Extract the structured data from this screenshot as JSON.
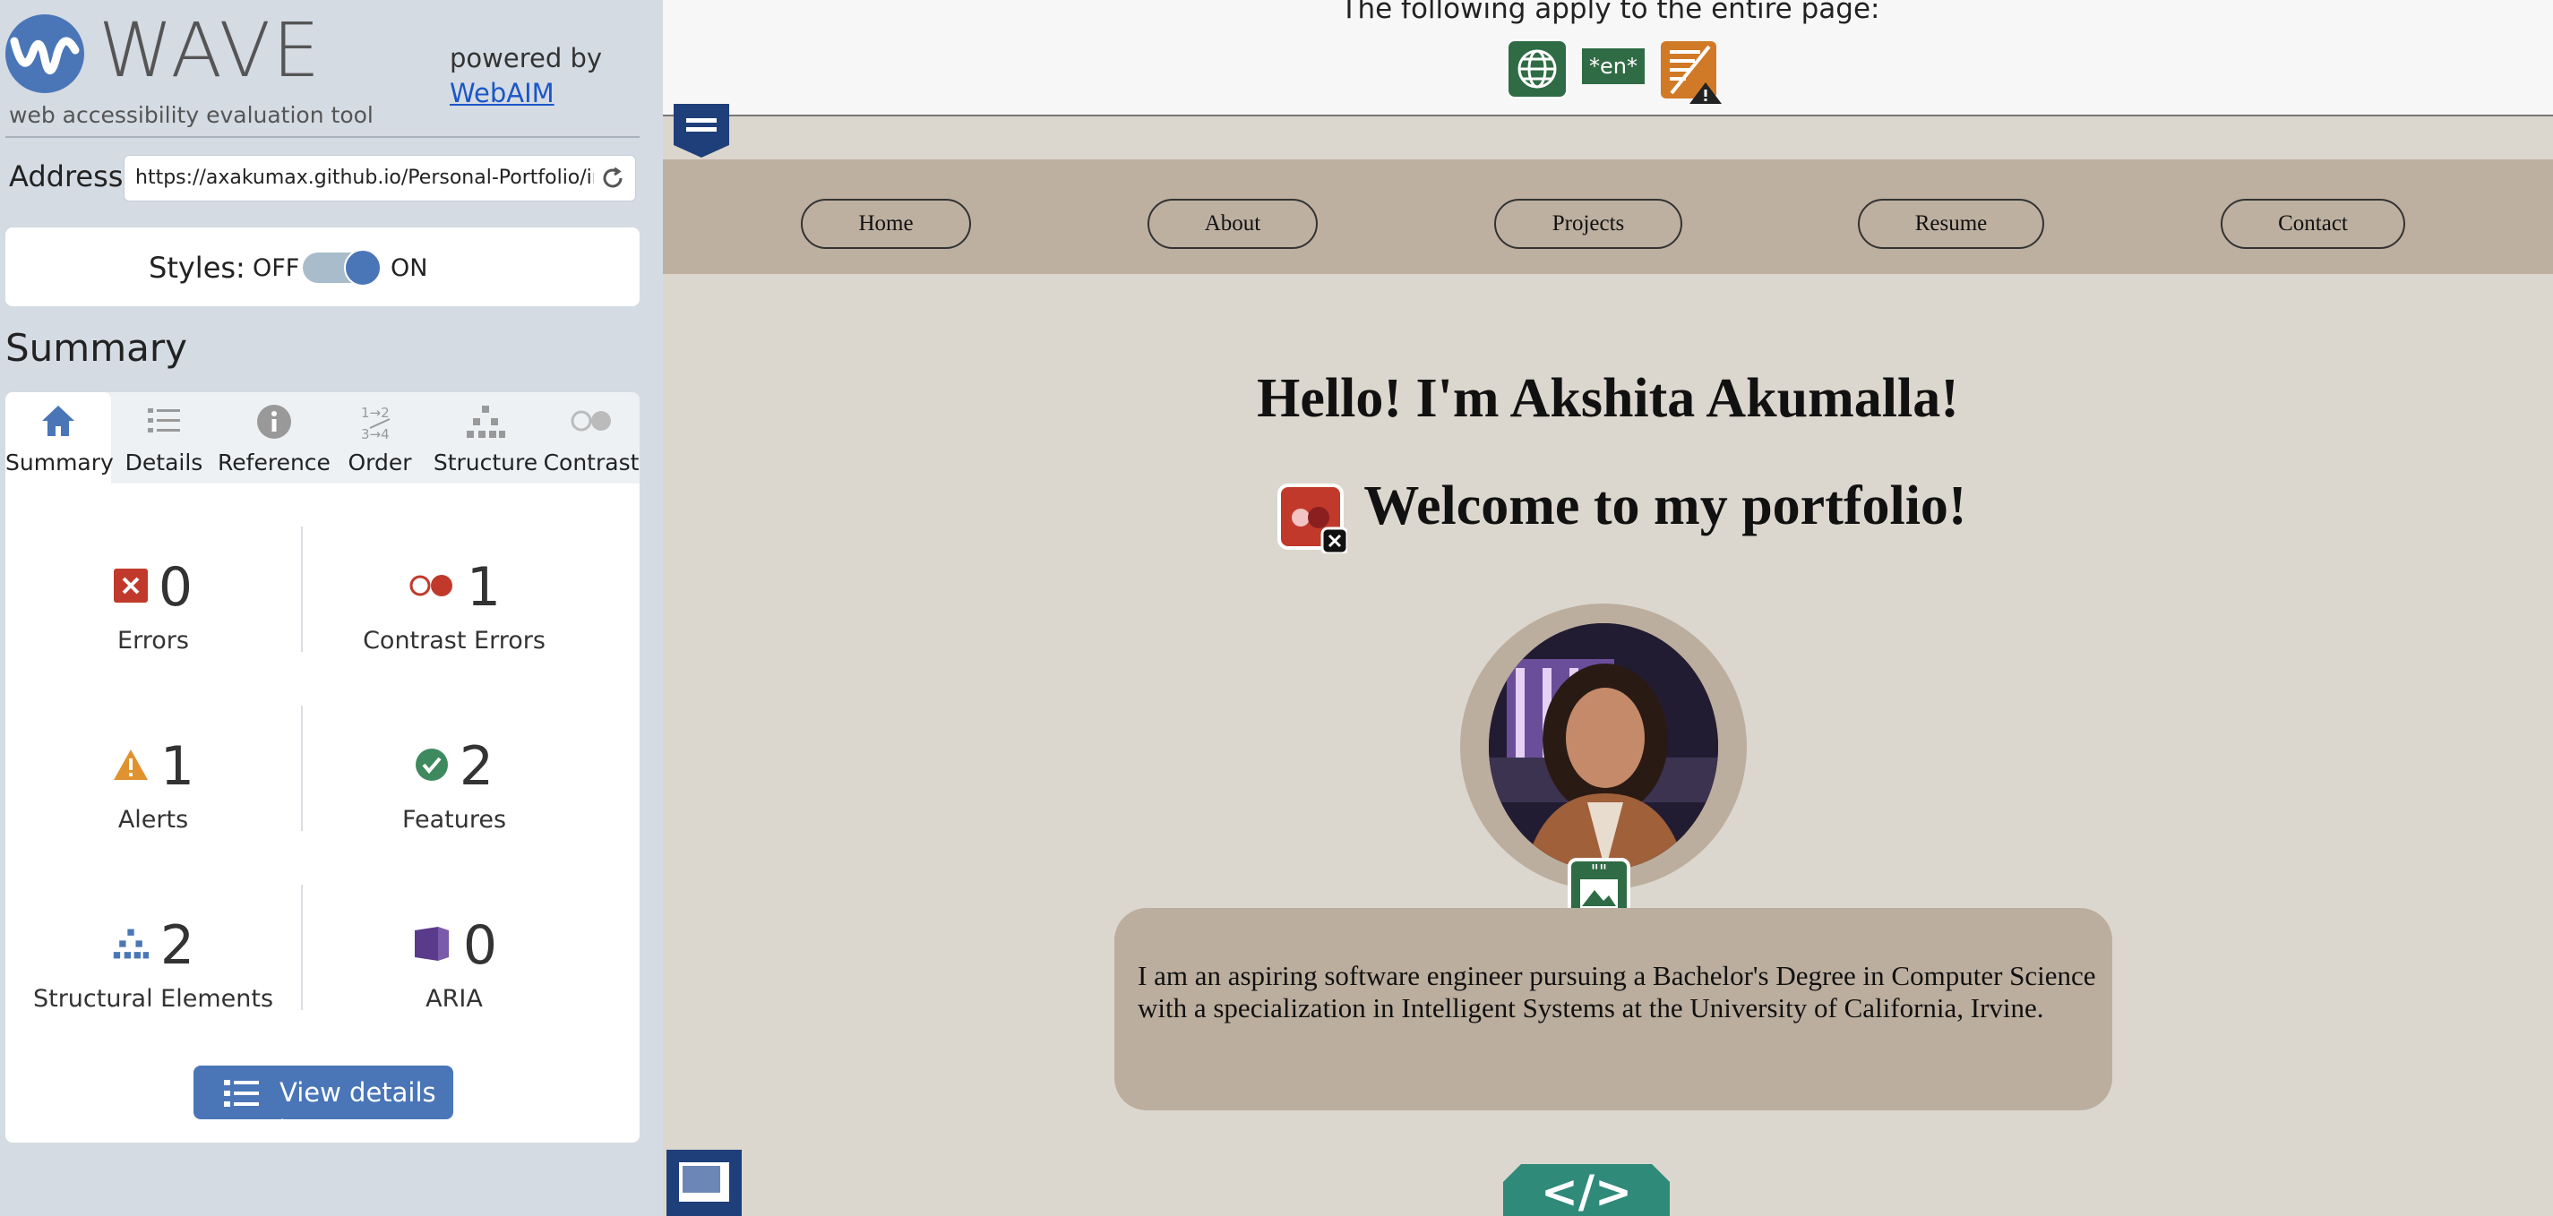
{
  "wave": {
    "logo_word": "WAVE",
    "tagline": "web accessibility evaluation tool",
    "powered_by": "powered by",
    "webaim_link": "WebAIM",
    "address_label": "Address:",
    "address_value": "https://axakumax.github.io/Personal-Portfolio/index.html",
    "styles_label": "Styles:",
    "styles_off": "OFF",
    "styles_on": "ON",
    "summary_title": "Summary",
    "tabs": [
      {
        "label": "Summary",
        "icon": "home-icon"
      },
      {
        "label": "Details",
        "icon": "list-icon"
      },
      {
        "label": "Reference",
        "icon": "info-icon"
      },
      {
        "label": "Order",
        "icon": "order-icon"
      },
      {
        "label": "Structure",
        "icon": "structure-icon"
      },
      {
        "label": "Contrast",
        "icon": "contrast-icon"
      }
    ],
    "stats": {
      "errors": {
        "value": "0",
        "label": "Errors"
      },
      "contrast_errors": {
        "value": "1",
        "label": "Contrast Errors"
      },
      "alerts": {
        "value": "1",
        "label": "Alerts"
      },
      "features": {
        "value": "2",
        "label": "Features"
      },
      "structural": {
        "value": "2",
        "label": "Structural Elements"
      },
      "aria": {
        "value": "0",
        "label": "ARIA"
      }
    },
    "view_details": "View details ›",
    "colors": {
      "accent": "#4a76b8",
      "error": "#c0392b",
      "alert": "#e0922f",
      "feature": "#3e8a5e",
      "aria": "#5a3a8a"
    }
  },
  "page": {
    "top_notice": "The following apply to the entire page:",
    "lang_badge": "*en*",
    "nav": [
      "Home",
      "About",
      "Projects",
      "Resume",
      "Contact"
    ],
    "heading1": "Hello! I'm Akshita Akumalla!",
    "heading2": "Welcome to my portfolio!",
    "bio": "I am an aspiring software engineer pursuing a Bachelor's Degree in Computer Science with a specialization in Intelligent Systems at the University of California, Irvine.",
    "code_badge": "</>"
  }
}
